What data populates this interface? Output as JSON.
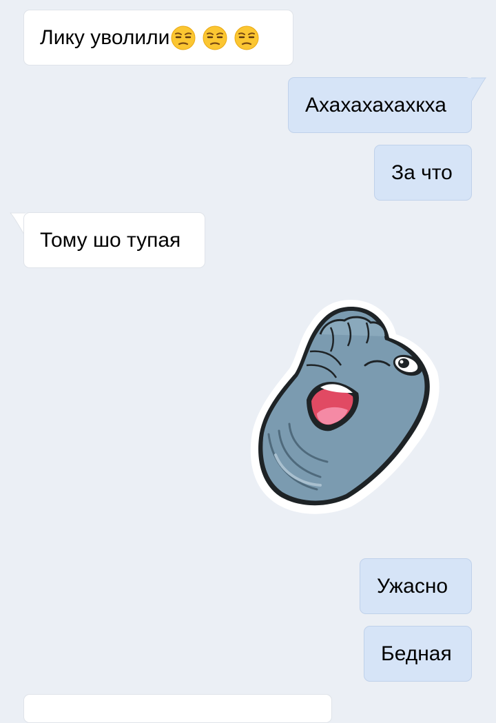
{
  "messages": [
    {
      "side": "incoming",
      "text": "Лику уволили",
      "emoji": [
        "unamused-face-emoji",
        "unamused-face-emoji",
        "unamused-face-emoji"
      ]
    },
    {
      "side": "outgoing",
      "text": "Ахахахахахкха"
    },
    {
      "side": "outgoing",
      "text": "За что"
    },
    {
      "side": "incoming",
      "text": "Тому шо тупая"
    },
    {
      "side": "outgoing",
      "type": "sticker",
      "sticker": "laughing-seal-sticker"
    },
    {
      "side": "outgoing",
      "text": "Ужасно"
    },
    {
      "side": "outgoing",
      "text": "Бедная"
    }
  ],
  "colors": {
    "background": "#ebeff5",
    "incoming_bubble": "#ffffff",
    "outgoing_bubble": "#d6e4f7",
    "sticker_body": "#7b9bb0"
  }
}
